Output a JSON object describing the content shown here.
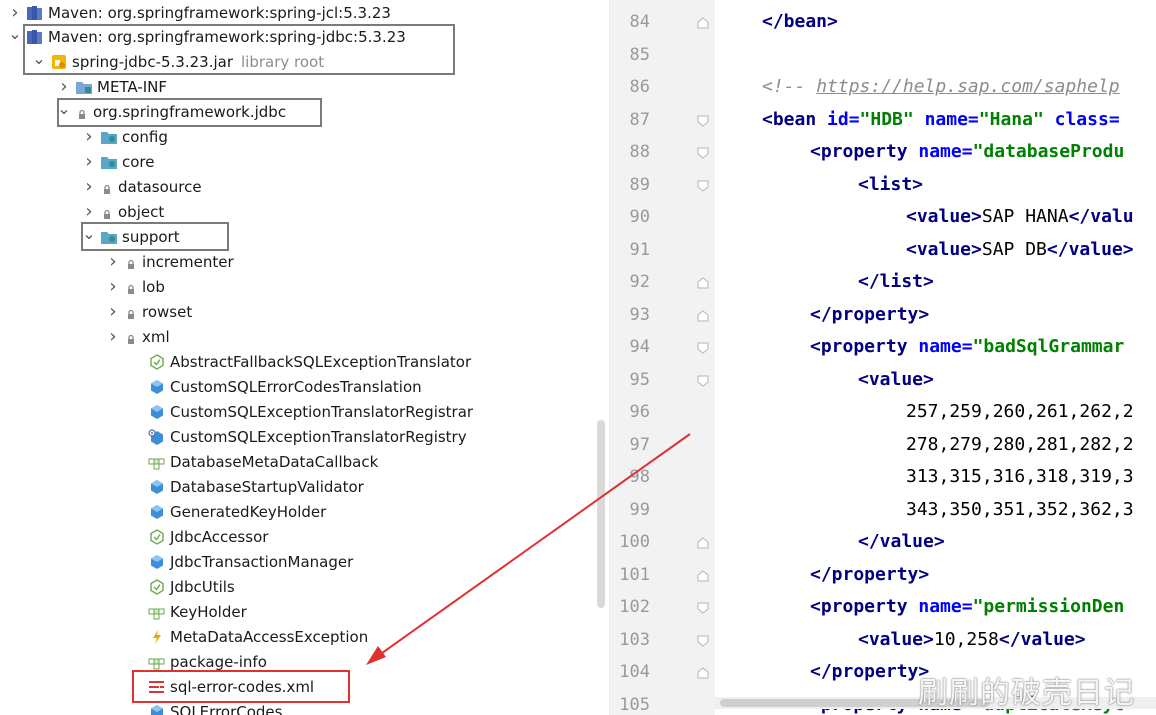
{
  "tree": {
    "rows": [
      {
        "label": "Maven: org.springframework:spring-jcl:5.3.23",
        "icon": "library-icon",
        "arrow": "right"
      },
      {
        "label": "Maven: org.springframework:spring-jdbc:5.3.23",
        "icon": "library-icon",
        "arrow": "down"
      },
      {
        "label": "spring-jdbc-5.3.23.jar",
        "hint": "library root",
        "icon": "jar-icon",
        "arrow": "down"
      },
      {
        "label": "META-INF",
        "icon": "folder-icon",
        "arrow": "right"
      },
      {
        "label": "org.springframework.jdbc",
        "icon": "package-lock-icon",
        "arrow": "down"
      },
      {
        "label": "config",
        "icon": "package-icon",
        "arrow": "right"
      },
      {
        "label": "core",
        "icon": "package-icon",
        "arrow": "right"
      },
      {
        "label": "datasource",
        "icon": "package-lock-icon",
        "arrow": "right"
      },
      {
        "label": "object",
        "icon": "package-lock-icon",
        "arrow": "right"
      },
      {
        "label": "support",
        "icon": "package-icon",
        "arrow": "down"
      },
      {
        "label": "incrementer",
        "icon": "package-lock-icon",
        "arrow": "right"
      },
      {
        "label": "lob",
        "icon": "package-lock-icon",
        "arrow": "right"
      },
      {
        "label": "rowset",
        "icon": "package-lock-icon",
        "arrow": "right"
      },
      {
        "label": "xml",
        "icon": "package-lock-icon",
        "arrow": "right"
      },
      {
        "label": "AbstractFallbackSQLExceptionTranslator",
        "icon": "abstract-class-icon",
        "arrow": ""
      },
      {
        "label": "CustomSQLErrorCodesTranslation",
        "icon": "class-icon",
        "arrow": ""
      },
      {
        "label": "CustomSQLExceptionTranslatorRegistrar",
        "icon": "class-icon",
        "arrow": ""
      },
      {
        "label": "CustomSQLExceptionTranslatorRegistry",
        "icon": "class-gear-icon",
        "arrow": ""
      },
      {
        "label": "DatabaseMetaDataCallback",
        "icon": "interface-icon",
        "arrow": ""
      },
      {
        "label": "DatabaseStartupValidator",
        "icon": "class-icon",
        "arrow": ""
      },
      {
        "label": "GeneratedKeyHolder",
        "icon": "class-icon",
        "arrow": ""
      },
      {
        "label": "JdbcAccessor",
        "icon": "abstract-class-icon",
        "arrow": ""
      },
      {
        "label": "JdbcTransactionManager",
        "icon": "class-icon",
        "arrow": ""
      },
      {
        "label": "JdbcUtils",
        "icon": "abstract-class-icon",
        "arrow": ""
      },
      {
        "label": "KeyHolder",
        "icon": "interface-icon",
        "arrow": ""
      },
      {
        "label": "MetaDataAccessException",
        "icon": "exception-icon",
        "arrow": ""
      },
      {
        "label": "package-info",
        "icon": "interface-icon",
        "arrow": ""
      },
      {
        "label": "sql-error-codes.xml",
        "icon": "xml-file-icon",
        "arrow": ""
      },
      {
        "label": "SQLErrorCodes",
        "icon": "class-icon",
        "arrow": ""
      }
    ]
  },
  "editor": {
    "line_numbers": [
      "84",
      "85",
      "86",
      "87",
      "88",
      "89",
      "90",
      "91",
      "92",
      "93",
      "94",
      "95",
      "96",
      "97",
      "98",
      "99",
      "100",
      "101",
      "102",
      "103",
      "104",
      "105"
    ]
  },
  "code": {
    "l84_close": "</bean>",
    "l86_open": "<!-- ",
    "l86_link": "https://help.sap.com/saphelp",
    "l87_open": "<bean",
    "l87_a1": " id=",
    "l87_v1": "\"HDB\"",
    "l87_a2": " name=",
    "l87_v2": "\"Hana\"",
    "l87_a3": " class=",
    "l88_tag": "<property",
    "l88_attr": " name=",
    "l88_val": "\"databaseProdu",
    "l89_tag": "<list>",
    "l90_open": "<value>",
    "l90_text": "SAP HANA",
    "l90_close": "</valu",
    "l91_open": "<value>",
    "l91_text": "SAP DB",
    "l91_close": "</value>",
    "l92_tag": "</list>",
    "l93_tag": "</property>",
    "l94_tag": "<property",
    "l94_attr": " name=",
    "l94_val": "\"badSqlGrammar",
    "l95_tag": "<value>",
    "l96_text": "257,259,260,261,262,2",
    "l97_text": "278,279,280,281,282,2",
    "l98_text": "313,315,316,318,319,3",
    "l99_text": "343,350,351,352,362,3",
    "l100_tag": "</value>",
    "l101_tag": "</property>",
    "l102_tag": "<property",
    "l102_attr": " name=",
    "l102_val": "\"permissionDen",
    "l103_open": "<value>",
    "l103_text": "10,258",
    "l103_close": "</value>",
    "l104_tag": "</property>",
    "l105_tag": "<property",
    "l105_attr": " name=",
    "l105_val": "\"duplicateKeyC"
  },
  "watermark": "刷刷的破壳日记",
  "colors": {
    "highlight_box": "#7a7a7a",
    "red_annotation": "#e03030",
    "xml_tag": "#000080",
    "xml_attr": "#0000ff",
    "xml_value": "#008000"
  }
}
